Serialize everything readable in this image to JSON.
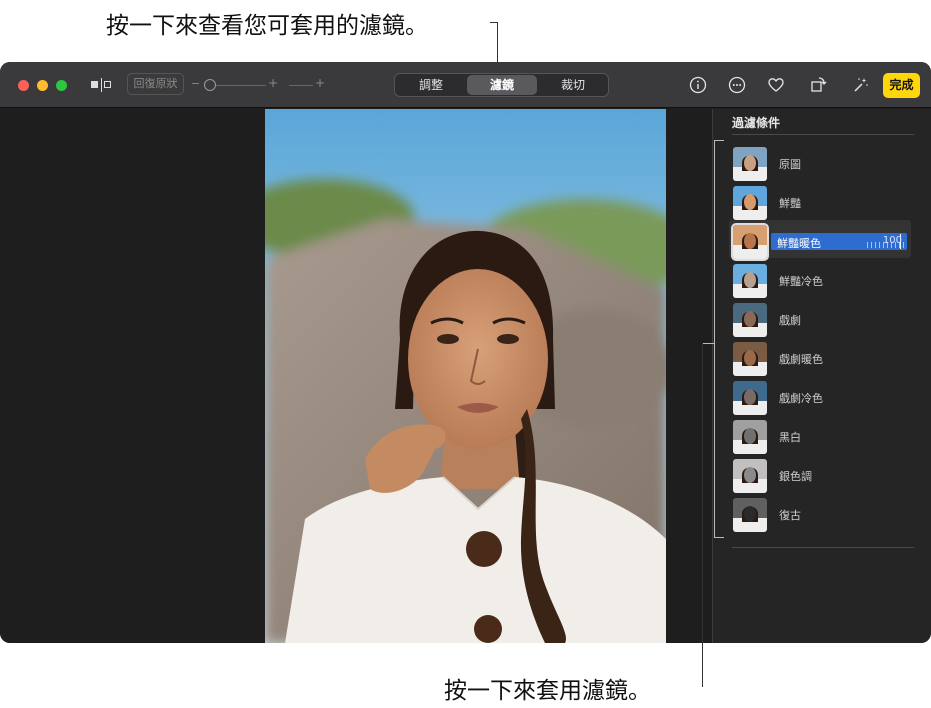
{
  "callouts": {
    "top": "按一下來查看您可套用的濾鏡。",
    "bottom": "按一下來套用濾鏡。"
  },
  "toolbar": {
    "revert_label": "回復原狀",
    "zoom_minus": "−",
    "zoom_plus": "+",
    "zoom2_plus": "+",
    "tabs": [
      {
        "label": "調整",
        "active": false
      },
      {
        "label": "濾鏡",
        "active": true
      },
      {
        "label": "裁切",
        "active": false
      }
    ],
    "icons": [
      "info-icon",
      "more-icon",
      "heart-icon",
      "rotate-icon",
      "magic-wand-icon"
    ],
    "done_label": "完成"
  },
  "sidebar": {
    "title": "過濾條件",
    "filters": [
      {
        "label": "原圖",
        "tone": "natural"
      },
      {
        "label": "鮮豔",
        "tone": "vivid"
      },
      {
        "label": "鮮豔暖色",
        "tone": "warm",
        "selected": true,
        "value": "100",
        "level": 1.0
      },
      {
        "label": "鮮豔冷色",
        "tone": "cool"
      },
      {
        "label": "戲劇",
        "tone": "dramatic"
      },
      {
        "label": "戲劇暖色",
        "tone": "dramatic-warm"
      },
      {
        "label": "戲劇冷色",
        "tone": "dramatic-cool"
      },
      {
        "label": "黑白",
        "tone": "mono"
      },
      {
        "label": "銀色調",
        "tone": "silver"
      },
      {
        "label": "復古",
        "tone": "noir"
      }
    ]
  },
  "colors": {
    "accent": "#2f6cd0",
    "done": "#ffd60a",
    "toolbar": "#3a3a3c",
    "sidebar": "#252525"
  }
}
